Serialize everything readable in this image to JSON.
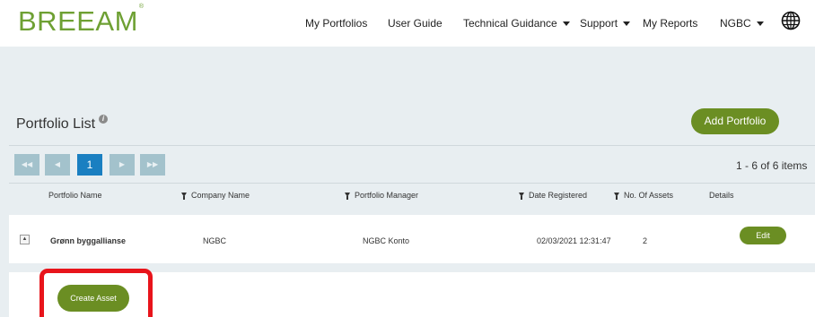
{
  "header": {
    "logo": "BREEAM",
    "logo_mark": "®",
    "nav": {
      "my_portfolios": "My Portfolios",
      "user_guide": "User Guide",
      "technical_guidance": "Technical Guidance",
      "support": "Support",
      "my_reports": "My Reports",
      "ngbc": "NGBC"
    },
    "language_icon": "globe-icon"
  },
  "main": {
    "title": "Portfolio List",
    "add_portfolio": "Add Portfolio",
    "pager": {
      "first": "◀◀",
      "prev": "◀",
      "current_page": "1",
      "next": "▶",
      "last": "▶▶",
      "items_text": "1 - 6 of 6 items"
    },
    "columns": {
      "portfolio_name": "Portfolio Name",
      "company_name": "Company Name",
      "portfolio_manager": "Portfolio Manager",
      "date_registered": "Date Registered",
      "no_of_assets": "No. Of Assets",
      "details": "Details"
    },
    "rows": [
      {
        "portfolio_name": "Grønn byggallianse",
        "company_name": "NGBC",
        "portfolio_manager": "NGBC Konto",
        "date_registered": "02/03/2021 12:31:47",
        "no_of_assets": "2",
        "edit": "Edit"
      }
    ],
    "create_asset": "Create Asset"
  },
  "colors": {
    "brand_green": "#6ea033",
    "button_green": "#6b8e23",
    "page_blue": "#1a7fc1",
    "highlight_red": "#e8141b"
  }
}
